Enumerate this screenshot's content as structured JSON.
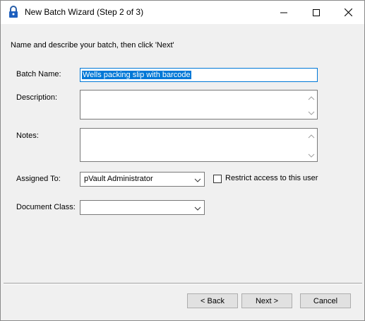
{
  "window": {
    "title": "New Batch Wizard (Step 2 of 3)",
    "app_icon": "lock-icon",
    "minimize_icon": "minimize-icon",
    "maximize_icon": "maximize-icon",
    "close_icon": "close-icon"
  },
  "instruction": "Name and describe your batch, then click 'Next'",
  "form": {
    "batch_name": {
      "label": "Batch Name:",
      "value": "Wells packing slip with barcode"
    },
    "description": {
      "label": "Description:",
      "value": ""
    },
    "notes": {
      "label": "Notes:",
      "value": ""
    },
    "assigned_to": {
      "label": "Assigned To:",
      "value": "pVault Administrator"
    },
    "restrict_access": {
      "label": "Restrict access to this user",
      "checked": false
    },
    "document_class": {
      "label": "Document Class:",
      "value": ""
    }
  },
  "buttons": {
    "back": "< Back",
    "next": "Next >",
    "cancel": "Cancel"
  },
  "colors": {
    "selection": "#0078d7",
    "window_bg": "#f0f0f0",
    "titlebar_bg": "#ffffff"
  }
}
